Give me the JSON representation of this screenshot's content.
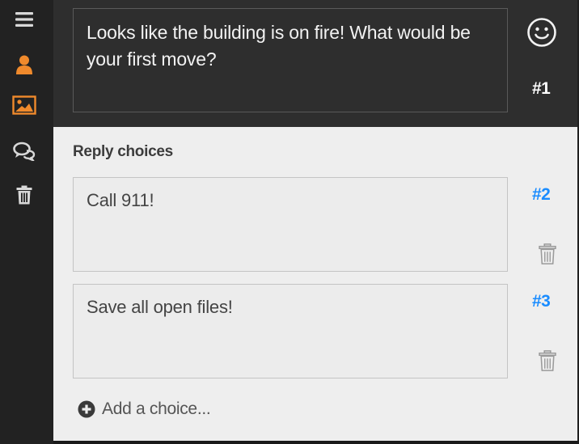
{
  "toolbar": {
    "items": [
      {
        "icon": "menu-icon"
      },
      {
        "icon": "person-icon",
        "color": "#f08a2c"
      },
      {
        "icon": "image-icon",
        "color": "#f08a2c"
      },
      {
        "icon": "chat-bubbles-icon"
      },
      {
        "icon": "trash-icon"
      }
    ]
  },
  "question": {
    "text": "Looks like the building is on fire! What would be your first move?",
    "number": "#1",
    "emoji_icon": "smiley-icon"
  },
  "replies": {
    "heading": "Reply choices",
    "choices": [
      {
        "text": "Call 911!",
        "number": "#2"
      },
      {
        "text": "Save all open files!",
        "number": "#3"
      }
    ],
    "add_label": "Add a choice..."
  },
  "colors": {
    "accent_orange": "#f08a2c",
    "choice_number_blue": "#1a8cff"
  }
}
